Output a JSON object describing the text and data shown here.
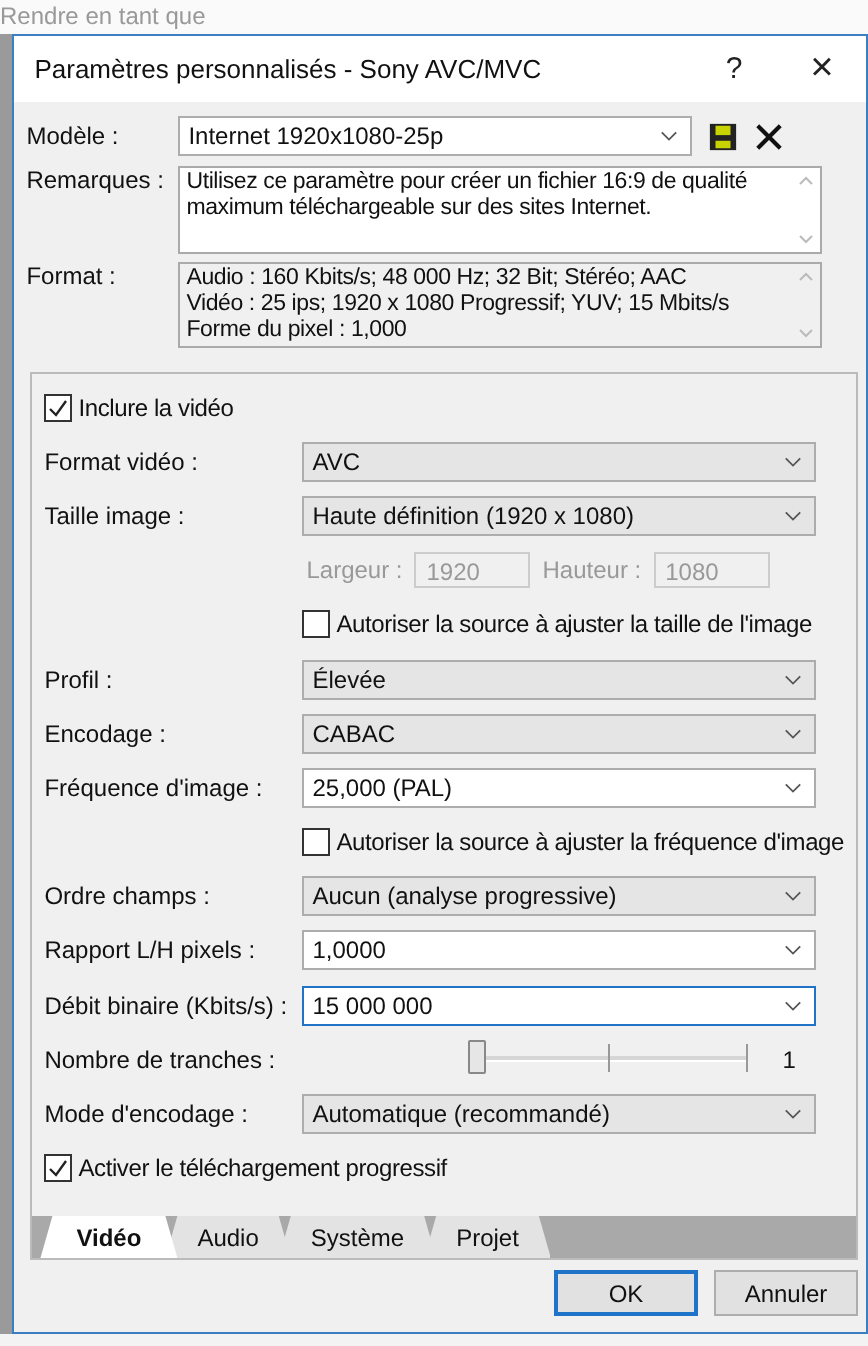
{
  "background": {
    "heading": "Rendre en tant que"
  },
  "window": {
    "title": "Paramètres personnalisés - Sony AVC/MVC",
    "help": "?",
    "close": "×"
  },
  "template": {
    "label": "Modèle :",
    "value": "Internet 1920x1080-25p"
  },
  "remarks": {
    "label": "Remarques :",
    "lines": [
      "Utilisez ce paramètre pour créer un fichier 16:9 de qualité",
      "maximum téléchargeable sur des sites Internet."
    ]
  },
  "format": {
    "label": "Format :",
    "lines": [
      "Audio : 160 Kbits/s; 48 000 Hz; 32 Bit; Stéréo; AAC",
      "Vidéo : 25 ips; 1920 x 1080 Progressif; YUV; 15 Mbits/s",
      "Forme du pixel : 1,000"
    ]
  },
  "rows": [
    {
      "kind": "checkbox",
      "label": "Inclure la vidéo",
      "checked": true
    },
    {
      "kind": "select",
      "label": "Format vidéo :",
      "value": "AVC"
    },
    {
      "kind": "select",
      "label": "Taille image :",
      "value": "Haute définition (1920 x 1080)"
    },
    {
      "kind": "dims",
      "disabled": true,
      "fields": [
        {
          "label": "Largeur :",
          "value": "1920"
        },
        {
          "label": "Hauteur :",
          "value": "1080"
        }
      ]
    },
    {
      "kind": "subcheckbox",
      "label": "Autoriser la source à ajuster la taille de l'image",
      "checked": false
    },
    {
      "kind": "select",
      "label": "Profil :",
      "value": "Élevée"
    },
    {
      "kind": "select",
      "label": "Encodage :",
      "value": "CABAC"
    },
    {
      "kind": "combo",
      "label": "Fréquence d'image :",
      "value": "25,000 (PAL)",
      "focused": false
    },
    {
      "kind": "subcheckbox",
      "label": "Autoriser la source à ajuster la fréquence d'image",
      "checked": false
    },
    {
      "kind": "select",
      "label": "Ordre champs :",
      "value": "Aucun (analyse progressive)"
    },
    {
      "kind": "combo",
      "label": "Rapport L/H pixels :",
      "value": "1,0000",
      "focused": false
    },
    {
      "kind": "combo",
      "label": "Débit binaire (Kbits/s) :",
      "value": "15 000 000",
      "focused": true
    },
    {
      "kind": "slider",
      "label": "Nombre de tranches :",
      "level": 0,
      "reading": "1"
    },
    {
      "kind": "select",
      "label": "Mode d'encodage :",
      "value": "Automatique (recommandé)"
    },
    {
      "kind": "checkbox",
      "label": "Activer le téléchargement progressif",
      "checked": true
    }
  ],
  "tabs": [
    {
      "label": "Vidéo",
      "selected": true
    },
    {
      "label": "Audio",
      "selected": false
    },
    {
      "label": "Système",
      "selected": false
    },
    {
      "label": "Projet",
      "selected": false
    }
  ],
  "buttons": [
    {
      "label": "OK",
      "default": true
    },
    {
      "label": "Annuler",
      "default": false
    }
  ]
}
